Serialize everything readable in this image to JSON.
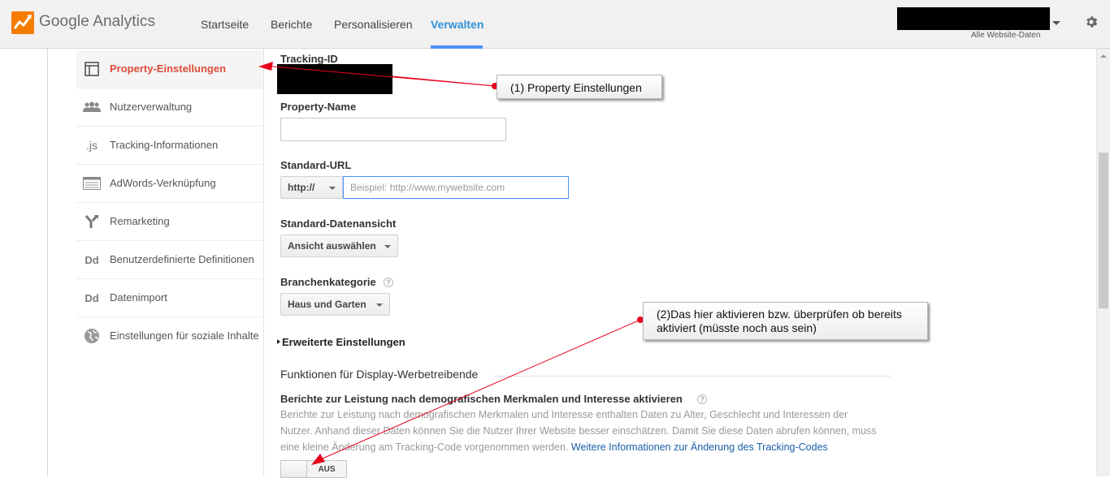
{
  "app": {
    "name": "Google Analytics",
    "logo_icon": "google-analytics-logo-icon"
  },
  "nav": {
    "items": [
      {
        "label": "Startseite",
        "active": false
      },
      {
        "label": "Berichte",
        "active": false
      },
      {
        "label": "Personalisieren",
        "active": false
      },
      {
        "label": "Verwalten",
        "active": true
      }
    ]
  },
  "account": {
    "subtitle": "Alle Website-Daten",
    "settings_icon": "gear-icon"
  },
  "sidebar": {
    "items": [
      {
        "label": "Property-Einstellungen",
        "icon": "property-icon",
        "active": true
      },
      {
        "label": "Nutzerverwaltung",
        "icon": "users-icon",
        "active": false
      },
      {
        "label": "Tracking-Informationen",
        "icon": "js-icon",
        "icon_text": ".js",
        "active": false
      },
      {
        "label": "AdWords-Verknüpfung",
        "icon": "adwords-icon",
        "active": false
      },
      {
        "label": "Remarketing",
        "icon": "remarketing-icon",
        "active": false
      },
      {
        "label": "Benutzerdefinierte Definitionen",
        "icon": "dd-icon",
        "icon_text": "Dd",
        "active": false
      },
      {
        "label": "Datenimport",
        "icon": "dd-icon",
        "icon_text": "Dd",
        "active": false
      },
      {
        "label": "Einstellungen für soziale Inhalte",
        "icon": "globe-icon",
        "active": false
      }
    ]
  },
  "form": {
    "tracking_id_label": "Tracking-ID",
    "property_name_label": "Property-Name",
    "property_name_value": "",
    "standard_url_label": "Standard-URL",
    "protocol_value": "http://",
    "url_placeholder": "Beispiel: http://www.mywebsite.com",
    "data_view_label": "Standard-Datenansicht",
    "data_view_value": "Ansicht auswählen",
    "category_label": "Branchenkategorie",
    "category_value": "Haus und Garten",
    "advanced_link": "Erweiterte Einstellungen",
    "display_section_title": "Funktionen für Display-Werbetreibende",
    "demographics_title": "Berichte zur Leistung nach demografischen Merkmalen und Interesse aktivieren",
    "demographics_description": "Berichte zur Leistung nach demografischen Merkmalen und Interesse enthalten Daten zu Alter, Geschlecht und Interessen der Nutzer. Anhand dieser Daten können Sie die Nutzer Ihrer Website besser einschätzen. Damit Sie diese Daten abrufen können, muss eine kleine Änderung am Tracking-Code vorgenommen werden.",
    "demographics_link": "Weitere Informationen zur Änderung des Tracking-Codes",
    "toggle_state": "AUS"
  },
  "annotations": [
    {
      "text": "(1) Property Einstellungen"
    },
    {
      "text": "(2)Das hier aktivieren bzw. überprüfen ob bereits aktiviert (müsste noch aus sein)"
    }
  ],
  "colors": {
    "accent_blue": "#2e8fd6",
    "active_red": "#dd4b39",
    "link_blue": "#1a5ea8",
    "annotation_red": "#e8001c"
  }
}
